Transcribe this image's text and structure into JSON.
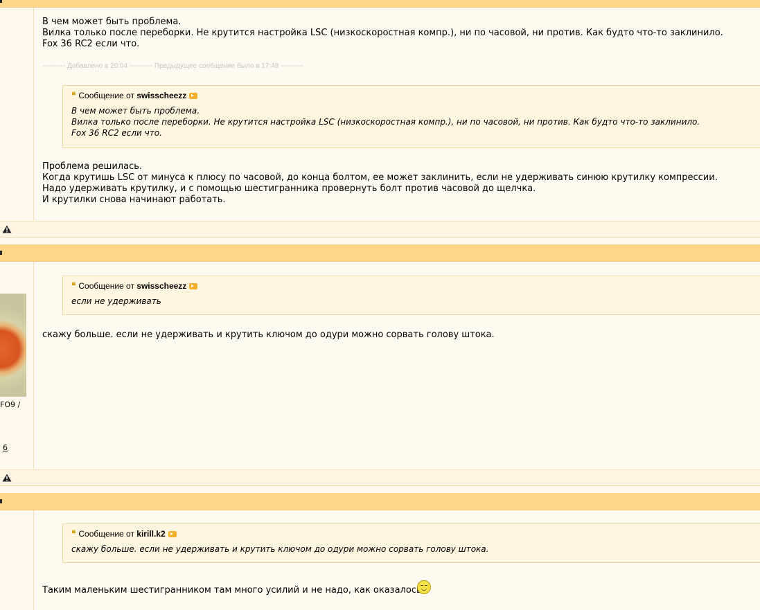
{
  "post1": {
    "body_lines": [
      "В чем может быть проблема.",
      "Вилка только после переборки. Не крутится настройка LSC (низкоскоростная компр.), ни по часовой, ни против. Как будто что-то заклинило.",
      "Fox 36 RC2 если что."
    ],
    "merge_notice": "---------- Добавлено в 20:04 ---------- Предыдущее сообщение было в 17:48 ----------",
    "quote": {
      "prefix": "Сообщение от",
      "author": "swisscheezz",
      "lines": [
        "В чем может быть проблема.",
        "Вилка только после переборки. Не крутится настройка LSC (низкоскоростная компр.), ни по часовой, ни против. Как будто что-то заклинило.",
        "Fox 36 RC2 если что."
      ]
    },
    "reply_lines": [
      "Проблема решилась.",
      "Когда крутишь LSC от минуса к плюсу по часовой, до конца болтом, ее может заклинить, если не удерживать синюю крутилку компрессии.",
      "Надо удерживать крутилку, и с помощью шестигранника провернуть болт против часовой до щелчка.",
      "И крутилки снова начинают работать."
    ]
  },
  "post2": {
    "user_info": "FO9 /",
    "user_link": "6",
    "quote": {
      "prefix": "Сообщение от",
      "author": "swisscheezz",
      "lines": [
        "если не удерживать"
      ]
    },
    "body": "скажу больше. если не удерживать и крутить ключом до одури можно сорвать голову штока."
  },
  "post3": {
    "quote": {
      "prefix": "Сообщение от",
      "author": "kirill.k2",
      "lines": [
        "скажу больше. если не удерживать и крутить ключом до одури можно сорвать голову штока."
      ]
    },
    "body": "Таким маленьким шестигранником там много усилий и не надо, как оказалось"
  },
  "icons": {
    "report": "warning-triangle-icon",
    "quote": "quote-marks-icon",
    "view_post": "arrow-link-icon",
    "smiley": "smile-icon"
  },
  "colors": {
    "header": "#fdd68a",
    "background": "#fff8ec",
    "quote_bg": "#fff6e0",
    "quote_border": "#f0d9a8",
    "muted": "#c6c6c6"
  }
}
